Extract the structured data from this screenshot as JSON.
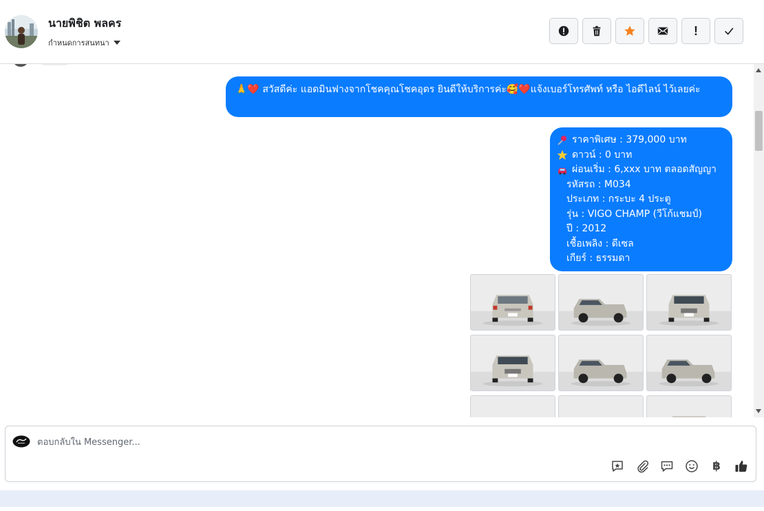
{
  "header": {
    "contact_name": "นายพิชิต พลคร",
    "assign_label": "กำหนดการสนทนา"
  },
  "toolbar": {
    "buttons": [
      {
        "name": "spam",
        "icon": "alert-circle-icon"
      },
      {
        "name": "delete",
        "icon": "trash-icon"
      },
      {
        "name": "follow-up",
        "icon": "star-icon",
        "color": "#f5821f"
      },
      {
        "name": "mark-unread",
        "icon": "envelope-icon"
      },
      {
        "name": "priority",
        "icon": "exclamation-icon",
        "label": "!"
      },
      {
        "name": "mark-done",
        "icon": "check-icon"
      }
    ]
  },
  "thread": {
    "messages": [
      {
        "id": "greeting",
        "text": "🙏❤️ สวัสดีค่ะ แอดมินฟางจากโชคคุณโชคอุดร ยินดีให้บริการค่ะ🥰❤️แจ้งเบอร์โทรศัพท์ หรือ ไอดีไลน์  ไว้เลยค่ะ"
      },
      {
        "id": "car-spec",
        "lines": [
          {
            "icon": "pushpin-icon",
            "text": "ราคาพิเศษ : 379,000 บาท"
          },
          {
            "icon": "star-emoji-icon",
            "text": "ดาวน์ : 0 บาท"
          },
          {
            "icon": "car-emoji-icon",
            "text": "ผ่อนเริ่ม : 6,xxx บาท ตลอดสัญญา"
          },
          {
            "icon": "",
            "text": "รหัสรถ : M034"
          },
          {
            "icon": "",
            "text": "ประเภท : กระบะ 4 ประตู"
          },
          {
            "icon": "",
            "text": "รุ่น : VIGO CHAMP (วีโก้แชมป์)"
          },
          {
            "icon": "",
            "text": "ปี : 2012"
          },
          {
            "icon": "",
            "text": "เชื้อเพลิง : ดีเซล"
          },
          {
            "icon": "",
            "text": "เกียร์ : ธรรมดา"
          }
        ]
      }
    ],
    "photos": [
      {
        "view": "rear"
      },
      {
        "view": "rear-quarter"
      },
      {
        "view": "front"
      },
      {
        "view": "front"
      },
      {
        "view": "front-quarter"
      },
      {
        "view": "front-quarter"
      },
      {
        "view": "front-quarter"
      },
      {
        "view": "front-quarter"
      },
      {
        "view": "rear"
      }
    ],
    "bubble_color": "#0a7cff"
  },
  "composer": {
    "placeholder": "ตอบกลับใน Messenger...",
    "tools": [
      {
        "name": "saved-reply",
        "icon": "saved-reply-icon"
      },
      {
        "name": "attach",
        "icon": "paperclip-icon"
      },
      {
        "name": "quick-replies",
        "icon": "chat-bubble-icon"
      },
      {
        "name": "emoji",
        "icon": "smiley-icon"
      },
      {
        "name": "payment",
        "icon": "baht-icon",
        "label": "฿"
      },
      {
        "name": "like",
        "icon": "thumbs-up-icon"
      }
    ]
  }
}
